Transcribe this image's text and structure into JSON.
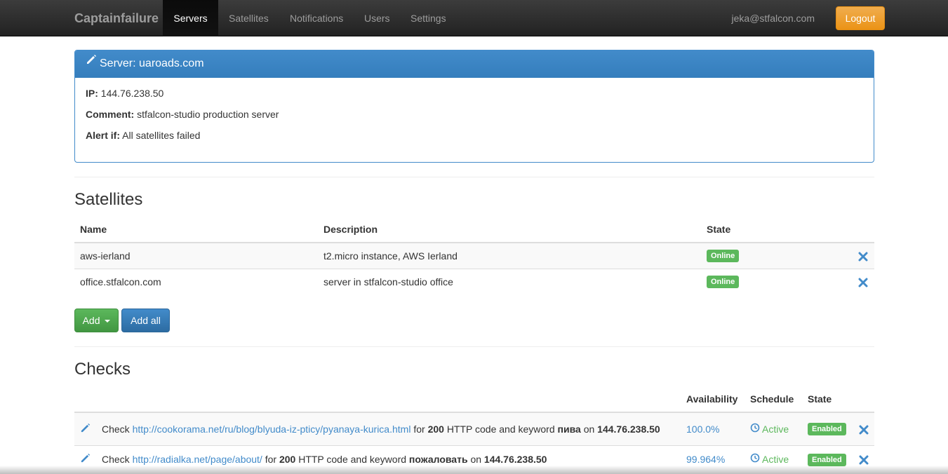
{
  "navbar": {
    "brand": "Captainfailure",
    "items": [
      {
        "label": "Servers",
        "active": true
      },
      {
        "label": "Satellites",
        "active": false
      },
      {
        "label": "Notifications",
        "active": false
      },
      {
        "label": "Users",
        "active": false
      },
      {
        "label": "Settings",
        "active": false
      }
    ],
    "user_email": "jeka@stfalcon.com",
    "logout_label": "Logout"
  },
  "server": {
    "heading_prefix": "Server:",
    "name": "uaroads.com",
    "ip_label": "IP:",
    "ip": "144.76.238.50",
    "comment_label": "Comment:",
    "comment": "stfalcon-studio production server",
    "alert_label": "Alert if:",
    "alert": "All satellites failed"
  },
  "satellites": {
    "title": "Satellites",
    "columns": {
      "name": "Name",
      "description": "Description",
      "state": "State"
    },
    "rows": [
      {
        "name": "aws-ierland",
        "description": "t2.micro instance, AWS Ierland",
        "state": "Online"
      },
      {
        "name": "office.stfalcon.com",
        "description": "server in stfalcon-studio office",
        "state": "Online"
      }
    ],
    "add_label": "Add",
    "add_all_label": "Add all"
  },
  "checks": {
    "title": "Checks",
    "columns": {
      "availability": "Availability",
      "schedule": "Schedule",
      "state": "State"
    },
    "rows": [
      {
        "prefix": "Check",
        "url": "http://cookorama.net/ru/blog/blyuda-iz-pticy/pyanaya-kurica.html",
        "for_text": "for",
        "code": "200",
        "mid_text": "HTTP code and keyword",
        "keyword": "пива",
        "on_text": "on",
        "ip": "144.76.238.50",
        "availability": "100.0%",
        "schedule": "Active",
        "state": "Enabled"
      },
      {
        "prefix": "Check",
        "url": "http://radialka.net/page/about/",
        "for_text": "for",
        "code": "200",
        "mid_text": "HTTP code and keyword",
        "keyword": "пожаловать",
        "on_text": "on",
        "ip": "144.76.238.50",
        "availability": "99.964%",
        "schedule": "Active",
        "state": "Enabled"
      }
    ]
  },
  "colors": {
    "primary": "#428bca",
    "success": "#5cb85c",
    "warning": "#f0ad4e",
    "navbar": "#222222"
  }
}
